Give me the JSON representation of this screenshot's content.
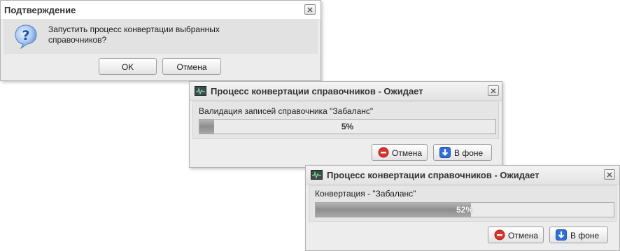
{
  "confirm_dialog": {
    "title": "Подтверждение",
    "message_line1": "Запустить процесс конвертации выбранных",
    "message_line2": "справочников?",
    "icon": "question-icon",
    "ok_label": "OK",
    "cancel_label": "Отмена"
  },
  "progress_dialogs": [
    {
      "title": "Процесс конвертации справочников - Ожидает",
      "status": "Валидация записей справочника  \"Забаланс\"",
      "progress_percent": 5,
      "progress_label": "5%",
      "cancel_label": "Отмена",
      "background_label": "В фоне"
    },
    {
      "title": "Процесс конвертации справочников - Ожидает",
      "status": "Конвертация - \"Забаланс\"",
      "progress_percent": 52,
      "progress_label": "52%",
      "cancel_label": "Отмена",
      "background_label": "В фоне"
    }
  ],
  "colors": {
    "cancel_icon": "#d9342b",
    "background_icon": "#2f6fd6",
    "question_icon": "#3a78d8"
  }
}
